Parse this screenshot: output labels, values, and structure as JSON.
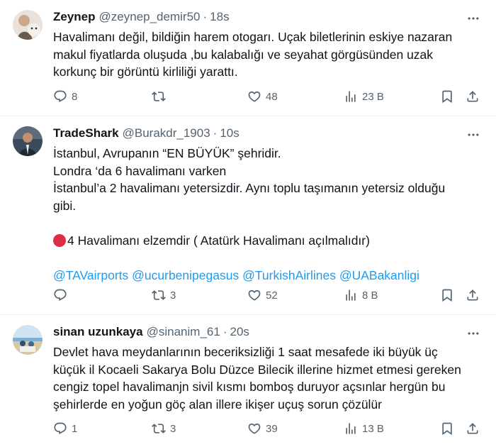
{
  "tweets": [
    {
      "name": "Zeynep",
      "handle": "@zeynep_demir50",
      "time": "18s",
      "lines": [
        "Havalimanı değil, bildiğin harem otogarı. Uçak biletlerinin eskiye nazaran",
        "makul fiyatlarda oluşuda ,bu kalabalığı ve seyahat görgüsünden uzak",
        "korkunç bir görüntü kirliliği yarattı."
      ],
      "replies": "8",
      "reposts": "",
      "likes": "48",
      "views": "23 B"
    },
    {
      "name": "TradeShark",
      "handle": "@Burakdr_1903",
      "time": "10s",
      "lines": [
        "İstanbul, Avrupanın “EN BÜYÜK” şehridir.",
        "Londra ‘da 6 havalimanı varken",
        "İstanbul’a 2 havalimanı yetersizdir. Aynı toplu taşımanın yetersiz olduğu",
        "gibi."
      ],
      "emoji_line": "4 Havalimanı elzemdir ( Atatürk Havalimanı açılmalıdır)",
      "mentions": [
        "@TAVairports",
        "@ucurbenipegasus",
        "@TurkishAirlines",
        "@UABakanligi"
      ],
      "replies": "",
      "reposts": "3",
      "likes": "52",
      "views": "8 B"
    },
    {
      "name": "sinan uzunkaya",
      "handle": "@sinanim_61",
      "time": "20s",
      "lines": [
        "Devlet hava meydanlarının beceriksizliği 1 saat mesafede iki büyük üç",
        "küçük il Kocaeli Sakarya Bolu  Düzce Bilecik illerine hizmet etmesi gereken",
        "cengiz topel havalimanjn sivil kısmı bomboş duruyor açsınlar hergün bu",
        "şehirlerde en yoğun göç alan illere ikişer uçuş sorun çözülür"
      ],
      "replies": "1",
      "reposts": "3",
      "likes": "39",
      "views": "13 B"
    }
  ],
  "separator": "·",
  "icons": [
    "reply-icon",
    "repost-icon",
    "like-icon",
    "views-icon",
    "bookmark-icon",
    "share-icon",
    "more-icon"
  ],
  "colors": {
    "text": "#0f1419",
    "secondary": "#536471",
    "link": "#1d9bf0",
    "divider": "#eff3f4",
    "emoji_red": "#dd2e44"
  }
}
